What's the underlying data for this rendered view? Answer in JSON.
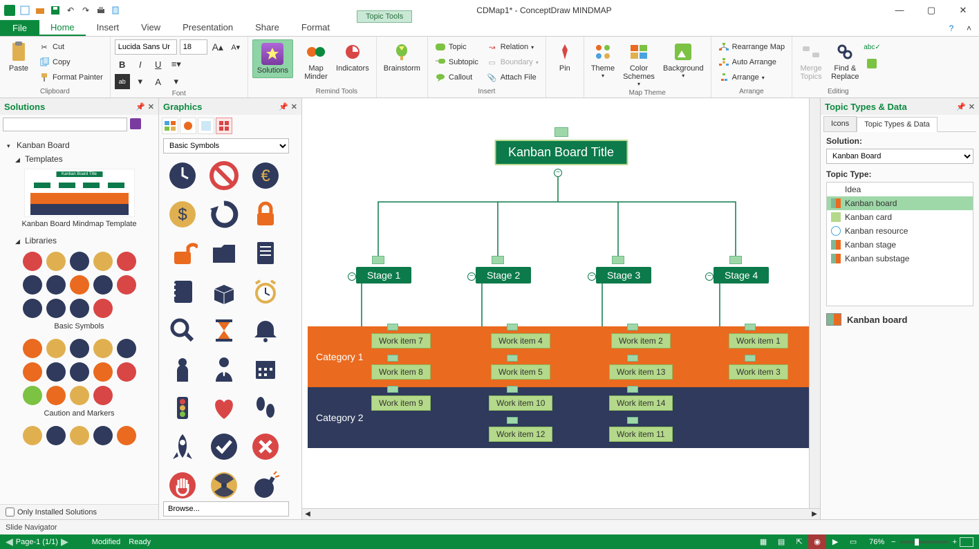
{
  "title": "CDMap1* - ConceptDraw MINDMAP",
  "topic_tools": "Topic Tools",
  "window": {
    "min": "—",
    "max": "▢",
    "close": "✕"
  },
  "menu": {
    "file": "File",
    "tabs": [
      "Home",
      "Insert",
      "View",
      "Presentation",
      "Share",
      "Format"
    ],
    "active": 0
  },
  "ribbon": {
    "clipboard": {
      "paste": "Paste",
      "cut": "Cut",
      "copy": "Copy",
      "format_painter": "Format Painter",
      "label": "Clipboard"
    },
    "font": {
      "family": "Lucida Sans Ur",
      "size": "18",
      "label": "Font"
    },
    "solutions": {
      "btn": "Solutions"
    },
    "remind": {
      "mapminder": "Map\nMinder",
      "indicators": "Indicators",
      "label": "Remind Tools"
    },
    "brainstorm": "Brainstorm",
    "insert": {
      "topic": "Topic",
      "subtopic": "Subtopic",
      "callout": "Callout",
      "relation": "Relation",
      "boundary": "Boundary",
      "attach_file": "Attach  File",
      "label": "Insert"
    },
    "pin": "Pin",
    "maptheme": {
      "theme": "Theme",
      "color_schemes": "Color\nSchemes",
      "background": "Background",
      "label": "Map Theme"
    },
    "arrange": {
      "rearrange": "Rearrange Map",
      "auto": "Auto Arrange",
      "arrange": "Arrange",
      "label": "Arrange"
    },
    "editing": {
      "merge": "Merge\nTopics",
      "findreplace": "Find &\nReplace",
      "label": "Editing"
    }
  },
  "solutions_panel": {
    "title": "Solutions",
    "search_placeholder": "",
    "root": "Kanban Board",
    "templates_label": "Templates",
    "template_name": "Kanban Board Mindmap Template",
    "libraries_label": "Libraries",
    "lib1": "Basic Symbols",
    "lib2": "Caution and Markers",
    "only_installed": "Only Installed Solutions"
  },
  "graphics_panel": {
    "title": "Graphics",
    "dropdown": "Basic Symbols",
    "browse": "Browse...",
    "symbols": [
      "clock",
      "no-entry",
      "euro",
      "dollar",
      "refresh",
      "lock-closed",
      "lock-open",
      "folder",
      "document",
      "notebook",
      "box-open",
      "alarm-clock",
      "magnifier",
      "hourglass",
      "bell",
      "person",
      "manager",
      "calendar",
      "traffic-light",
      "heart",
      "footprints",
      "rocket",
      "check-circle",
      "x-circle",
      "stop-hand",
      "radiation",
      "bomb"
    ]
  },
  "canvas": {
    "title": "Kanban Board Title",
    "stages": [
      "Stage 1",
      "Stage 2",
      "Stage 3",
      "Stage 4"
    ],
    "categories": [
      "Category 1",
      "Category 2"
    ],
    "items": {
      "s1": [
        "Work item 7",
        "Work item 8",
        "Work item 9"
      ],
      "s2": [
        "Work item 4",
        "Work item 5",
        "Work item 10",
        "Work item 12"
      ],
      "s3": [
        "Work item 2",
        "Work item 13",
        "Work item 14",
        "Work item 11"
      ],
      "s4": [
        "Work item 1",
        "Work item 3"
      ]
    }
  },
  "tt_panel": {
    "title": "Topic Types & Data",
    "tabs": [
      "Icons",
      "Topic Types & Data"
    ],
    "solution_label": "Solution:",
    "solution_value": "Kanban Board",
    "topictype_label": "Topic Type:",
    "types": [
      "Idea",
      "Kanban board",
      "Kanban card",
      "Kanban resource",
      "Kanban stage",
      "Kanban substage"
    ],
    "selected_index": 1,
    "current": "Kanban board"
  },
  "slidenav": "Slide Navigator",
  "status": {
    "page": "Page-1 (1/1)",
    "modified": "Modified",
    "ready": "Ready",
    "zoom": "76%"
  }
}
